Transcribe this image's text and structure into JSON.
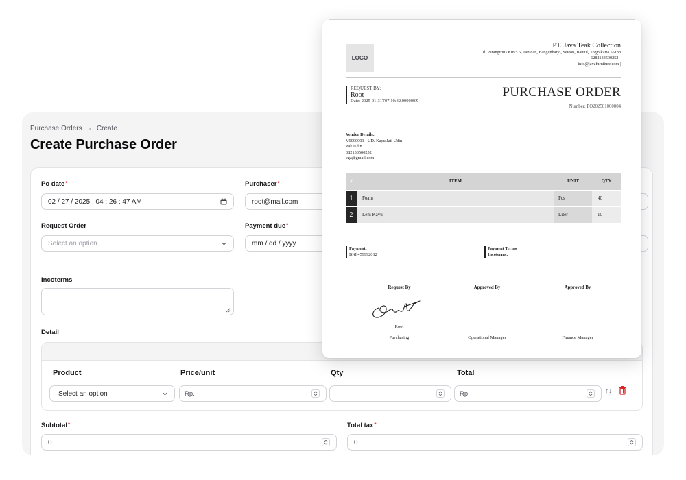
{
  "breadcrumb": {
    "parent": "Purchase Orders",
    "separator": ">",
    "current": "Create"
  },
  "page_title": "Create Purchase Order",
  "form": {
    "po_date": {
      "label": "Po date",
      "value": "02 / 27 / 2025 ,  04 : 26 : 47   AM"
    },
    "purchaser": {
      "label": "Purchaser",
      "value": "root@mail.com"
    },
    "request_order": {
      "label": "Request Order",
      "placeholder": "Select an option"
    },
    "payment_due": {
      "label": "Payment due",
      "placeholder": "mm / dd / yyyy"
    },
    "incoterms": {
      "label": "Incoterms"
    },
    "detail": {
      "label": "Detail",
      "columns": {
        "product": "Product",
        "price": "Price/unit",
        "qty": "Qty",
        "total": "Total"
      },
      "product_placeholder": "Select an option",
      "currency_prefix": "Rp."
    },
    "subtotal": {
      "label": "Subtotal",
      "value": "0"
    },
    "total_tax": {
      "label": "Total tax",
      "value": "0"
    },
    "required_mark": "*"
  },
  "document": {
    "logo": "LOGO",
    "company": {
      "name": "PT. Java Teak Collection",
      "address": "Jl. Parangtritis Km 5.5, Tarudan, Bangunharjo, Sewon, Bantul, Yogyakarta 55188",
      "phone": "6282133500252 -",
      "email": "info@javafurniture.com |"
    },
    "request_by_label": "REQUEST BY:",
    "request_by_name": "Root",
    "date": "Date: 2025-01-31T07:10:32.000000Z",
    "title": "PURCHASE ORDER",
    "number": "Number: PO202501000004",
    "vendor": {
      "heading": "Vendor Details:",
      "line1": "V0000001 - UD. Kayu Jati Udin",
      "line2": "Pak Udin",
      "line3": "082133500252",
      "line4": "ega@gmail.com"
    },
    "table": {
      "headers": {
        "num": "#",
        "item": "ITEM",
        "unit": "UNIT",
        "qty": "QTY"
      },
      "rows": [
        {
          "num": "1",
          "item": "Foam",
          "unit": "Pcs",
          "qty": "40"
        },
        {
          "num": "2",
          "item": "Lem Kayu",
          "unit": "Liter",
          "qty": "10"
        }
      ]
    },
    "payment": {
      "label": "Payment:",
      "value": "BNI 459992012"
    },
    "terms": {
      "label": "Payment Terms",
      "incoterms": "Incoterms:"
    },
    "signatures": {
      "request": {
        "title": "Request By",
        "name": "Root",
        "role": "Purchasing"
      },
      "approved1": {
        "title": "Approved By",
        "role": "Operational Manager"
      },
      "approved2": {
        "title": "Approved By",
        "role": "Finance Manager"
      }
    }
  },
  "colors": {
    "required": "#dc2626",
    "delete": "#dc2626",
    "doc_bar": "#262626"
  }
}
